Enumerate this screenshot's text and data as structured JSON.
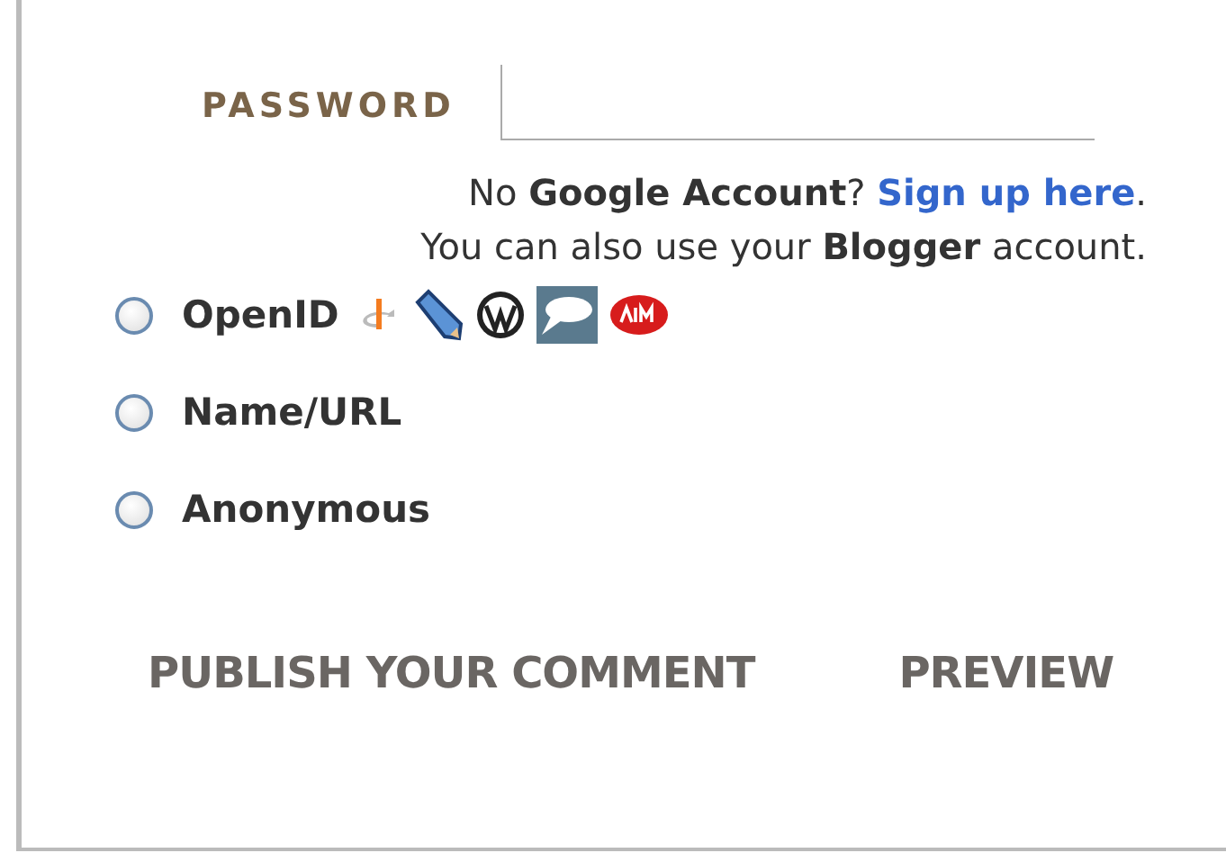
{
  "password_field": {
    "label": "PASSWORD"
  },
  "account_note": {
    "line_1": "No **Google Account**?",
    "link": "Sign up here",
    "line_1_end": ".",
    "line_2": "You can also use your **Blogger** account."
  },
  "identity_options": [
    {
      "label": "OpenID",
      "selected": false,
      "kind": "providers"
    },
    {
      "label": "Name/URL",
      "selected": false,
      "kind": "plain"
    },
    {
      "label": "Anonymous",
      "selected": false,
      "kind": "plain"
    }
  ],
  "buttons": [
    {
      "label": "PUBLISH YOUR COMMENT"
    },
    {
      "label": "PREVIEW"
    }
  ]
}
